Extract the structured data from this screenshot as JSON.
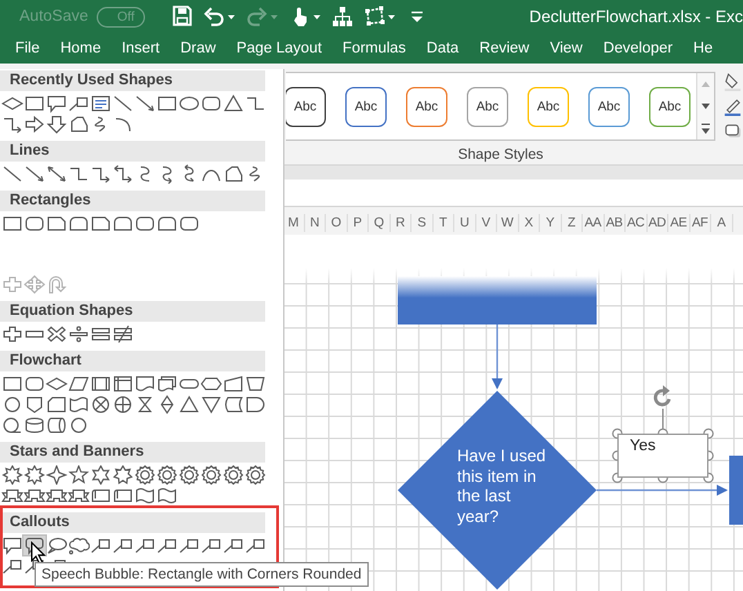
{
  "title_bar": {
    "autosave_label": "AutoSave",
    "autosave": {
      "label": "Off",
      "on": false
    },
    "document_title": "DeclutterFlowchart.xlsx  -  Exc",
    "quick_access": [
      {
        "kind": "save",
        "disabled": false
      },
      {
        "kind": "undo",
        "disabled": false
      },
      {
        "kind": "caret",
        "disabled": false
      },
      {
        "kind": "redo",
        "disabled": true
      },
      {
        "kind": "caret",
        "disabled": true
      },
      {
        "kind": "touch",
        "disabled": false
      },
      {
        "kind": "caret",
        "disabled": false
      },
      {
        "kind": "hierarchy",
        "disabled": false
      },
      {
        "kind": "edit-shape",
        "disabled": false
      },
      {
        "kind": "caret",
        "disabled": false
      },
      {
        "kind": "customize",
        "disabled": false
      }
    ]
  },
  "ribbon_tabs": [
    {
      "label": "File",
      "selected": false
    },
    {
      "label": "Home",
      "selected": false
    },
    {
      "label": "Insert",
      "selected": false
    },
    {
      "label": "Draw",
      "selected": false
    },
    {
      "label": "Page Layout",
      "selected": false
    },
    {
      "label": "Formulas",
      "selected": false
    },
    {
      "label": "Data",
      "selected": false
    },
    {
      "label": "Review",
      "selected": false
    },
    {
      "label": "View",
      "selected": false
    },
    {
      "label": "Developer",
      "selected": false
    },
    {
      "label": "He",
      "selected": false
    }
  ],
  "shape_styles": {
    "label": "Shape Styles",
    "presets": [
      {
        "label": "Abc",
        "color": "#404040"
      },
      {
        "label": "Abc",
        "color": "#4472c4"
      },
      {
        "label": "Abc",
        "color": "#ed7d31"
      },
      {
        "label": "Abc",
        "color": "#a5a5a5"
      },
      {
        "label": "Abc",
        "color": "#ffc000"
      },
      {
        "label": "Abc",
        "color": "#5b9bd5"
      },
      {
        "label": "Abc",
        "color": "#70ad47"
      }
    ]
  },
  "column_headers": [
    "M",
    "N",
    "O",
    "P",
    "Q",
    "R",
    "S",
    "T",
    "U",
    "V",
    "W",
    "X",
    "Y",
    "Z",
    "AA",
    "AB",
    "AC",
    "AD",
    "AE",
    "AF",
    "A"
  ],
  "shapes_panel": {
    "sections": [
      {
        "title": "Recently Used Shapes",
        "shapes": [
          {
            "kind": "diamond"
          },
          {
            "kind": "rectangle"
          },
          {
            "kind": "speech-bubble"
          },
          {
            "kind": "line-callout"
          },
          {
            "kind": "text-box"
          },
          {
            "kind": "line"
          },
          {
            "kind": "arrow"
          },
          {
            "kind": "rectangle"
          },
          {
            "kind": "oval"
          },
          {
            "kind": "rounded-rectangle"
          },
          {
            "kind": "triangle"
          },
          {
            "kind": "elbow-connector"
          },
          {
            "kind": "elbow-arrow"
          },
          {
            "kind": "block-arrow-right"
          },
          {
            "kind": "block-arrow-down"
          },
          {
            "kind": "freeform"
          },
          {
            "kind": "scribble"
          },
          {
            "kind": "arc"
          }
        ]
      },
      {
        "title": "Lines",
        "shapes": [
          {
            "kind": "line"
          },
          {
            "kind": "arrow"
          },
          {
            "kind": "double-arrow"
          },
          {
            "kind": "elbow-connector"
          },
          {
            "kind": "elbow-arrow"
          },
          {
            "kind": "elbow-double-arrow"
          },
          {
            "kind": "curved-connector"
          },
          {
            "kind": "curved-arrow"
          },
          {
            "kind": "curved-double-arrow"
          },
          {
            "kind": "curve"
          },
          {
            "kind": "freeform"
          },
          {
            "kind": "scribble"
          }
        ]
      },
      {
        "title": "Rectangles",
        "shapes": [
          {
            "kind": "rectangle"
          },
          {
            "kind": "rounded-rectangle"
          },
          {
            "kind": "snipped-rectangle"
          },
          {
            "kind": "round-top-rectangle"
          },
          {
            "kind": "snipped-rectangle"
          },
          {
            "kind": "round-top-rectangle"
          },
          {
            "kind": "rounded-rectangle"
          },
          {
            "kind": "round-top-rectangle"
          },
          {
            "kind": "rounded-rectangle"
          }
        ]
      },
      {
        "faded": true,
        "shapes": [
          {
            "kind": "plus"
          },
          {
            "kind": "four-arrows"
          },
          {
            "kind": "u-turn-arrow"
          }
        ]
      },
      {
        "title": "Equation Shapes",
        "shapes": [
          {
            "kind": "plus"
          },
          {
            "kind": "minus"
          },
          {
            "kind": "multiply"
          },
          {
            "kind": "divide"
          },
          {
            "kind": "equal"
          },
          {
            "kind": "not-equal"
          }
        ]
      },
      {
        "title": "Flowchart",
        "shapes": [
          {
            "kind": "rectangle"
          },
          {
            "kind": "rounded-rectangle"
          },
          {
            "kind": "diamond"
          },
          {
            "kind": "parallelogram"
          },
          {
            "kind": "predefined-process"
          },
          {
            "kind": "internal-storage"
          },
          {
            "kind": "document"
          },
          {
            "kind": "multidocument"
          },
          {
            "kind": "terminator"
          },
          {
            "kind": "hexagon"
          },
          {
            "kind": "manual-input"
          },
          {
            "kind": "trapezoid"
          },
          {
            "kind": "circle"
          },
          {
            "kind": "shield"
          },
          {
            "kind": "card"
          },
          {
            "kind": "punched-tape"
          },
          {
            "kind": "summing-junction"
          },
          {
            "kind": "or-symbol"
          },
          {
            "kind": "hourglass"
          },
          {
            "kind": "sort"
          },
          {
            "kind": "triangle"
          },
          {
            "kind": "inverted-triangle"
          },
          {
            "kind": "stored-data"
          },
          {
            "kind": "delay"
          },
          {
            "kind": "sequential-storage"
          },
          {
            "kind": "cylinder"
          },
          {
            "kind": "direct-access"
          },
          {
            "kind": "circle"
          }
        ]
      },
      {
        "title": "Stars and Banners",
        "shapes": [
          {
            "kind": "burst"
          },
          {
            "kind": "burst"
          },
          {
            "kind": "star-four"
          },
          {
            "kind": "star-five"
          },
          {
            "kind": "star-six"
          },
          {
            "kind": "star-seven"
          },
          {
            "kind": "seal"
          },
          {
            "kind": "seal"
          },
          {
            "kind": "seal"
          },
          {
            "kind": "seal"
          },
          {
            "kind": "seal"
          },
          {
            "kind": "seal"
          },
          {
            "kind": "banner"
          },
          {
            "kind": "banner"
          },
          {
            "kind": "banner"
          },
          {
            "kind": "banner"
          },
          {
            "kind": "scroll"
          },
          {
            "kind": "scroll"
          },
          {
            "kind": "wave"
          },
          {
            "kind": "wave"
          }
        ]
      },
      {
        "title": "Callouts",
        "highlighted": true,
        "shapes": [
          {
            "kind": "speech-bubble",
            "selected": false
          },
          {
            "kind": "rounded-speech-bubble",
            "selected": true
          },
          {
            "kind": "oval-speech-bubble",
            "selected": false
          },
          {
            "kind": "cloud-speech-bubble",
            "selected": false
          },
          {
            "kind": "line-callout",
            "selected": false
          },
          {
            "kind": "line-callout",
            "selected": false
          },
          {
            "kind": "line-callout",
            "selected": false
          },
          {
            "kind": "line-callout",
            "selected": false
          },
          {
            "kind": "line-callout",
            "selected": false
          },
          {
            "kind": "line-callout",
            "selected": false
          },
          {
            "kind": "line-callout",
            "selected": false
          },
          {
            "kind": "line-callout",
            "selected": false
          },
          {
            "kind": "line-callout",
            "selected": false
          },
          {
            "kind": "line-callout",
            "selected": false
          },
          {
            "kind": "line-callout",
            "selected": false
          }
        ]
      }
    ],
    "tooltip": "Speech Bubble: Rectangle with Corners Rounded"
  },
  "flowchart": {
    "decision": "Have I used this item in the last year?",
    "text_box": {
      "text": "Yes",
      "selected": true
    }
  }
}
